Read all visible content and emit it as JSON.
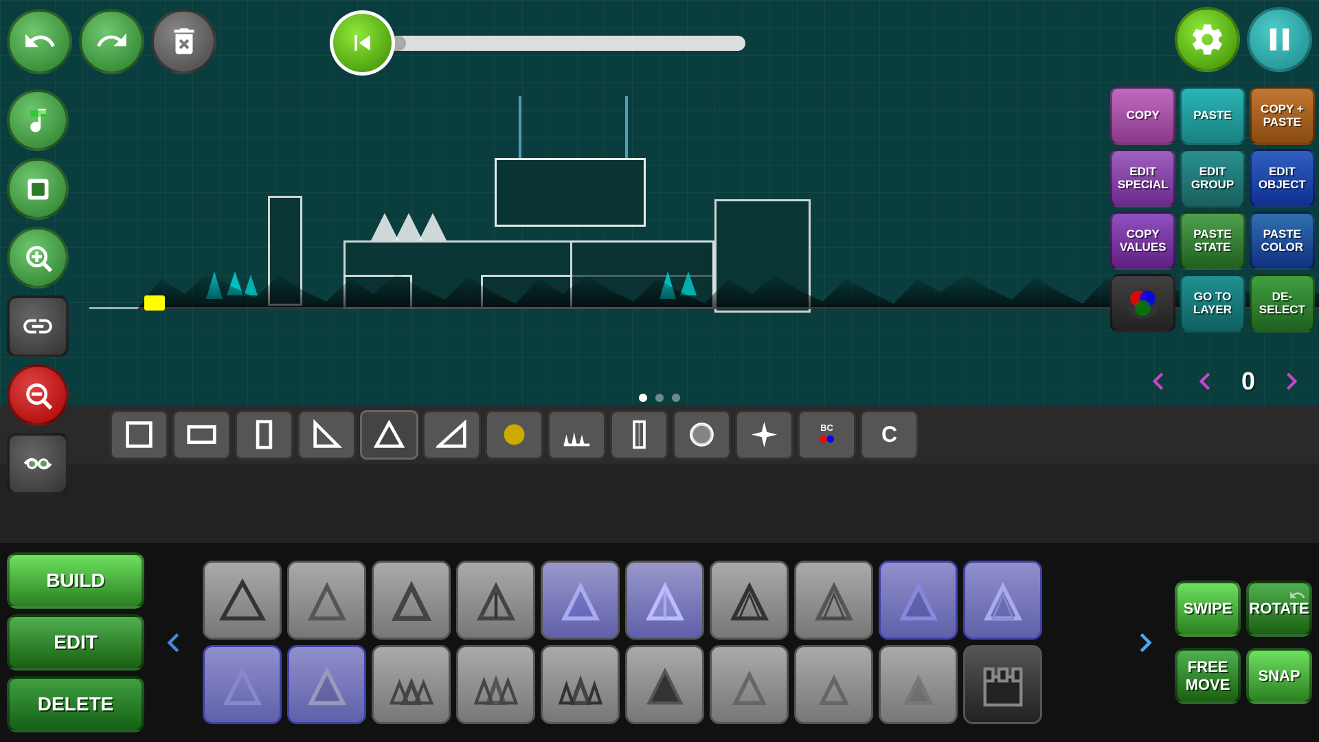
{
  "toolbar": {
    "undo_label": "↺",
    "redo_label": "↻",
    "delete_all_label": "🗑",
    "settings_label": "⚙",
    "pause_label": "⏸"
  },
  "playback": {
    "progress": 5
  },
  "right_panel": {
    "copy": "COPY",
    "paste": "PASTE",
    "copy_paste": "COPY + PASTE",
    "edit_special": "EDIT SPECIAL",
    "edit_group": "EDIT GROUP",
    "edit_object": "EDIT OBJECT",
    "copy_values": "COPY VALUES",
    "paste_state": "PASTE STATE",
    "paste_color": "PASTE COLOR",
    "go_to_layer": "GO TO LAYER",
    "deselect": "DE- SELECT"
  },
  "layer_nav": {
    "counter": "0",
    "prev_label": "◀",
    "next_label": "▶"
  },
  "mode_buttons": {
    "build": "BUILD",
    "edit": "EDIT",
    "delete": "DELETE"
  },
  "action_buttons": {
    "swipe": "SWIPE",
    "rotate": "ROTATE",
    "free_move": "FREE MOVE",
    "snap": "SNAP"
  },
  "dots": [
    1,
    2,
    3
  ],
  "active_dot": 1
}
